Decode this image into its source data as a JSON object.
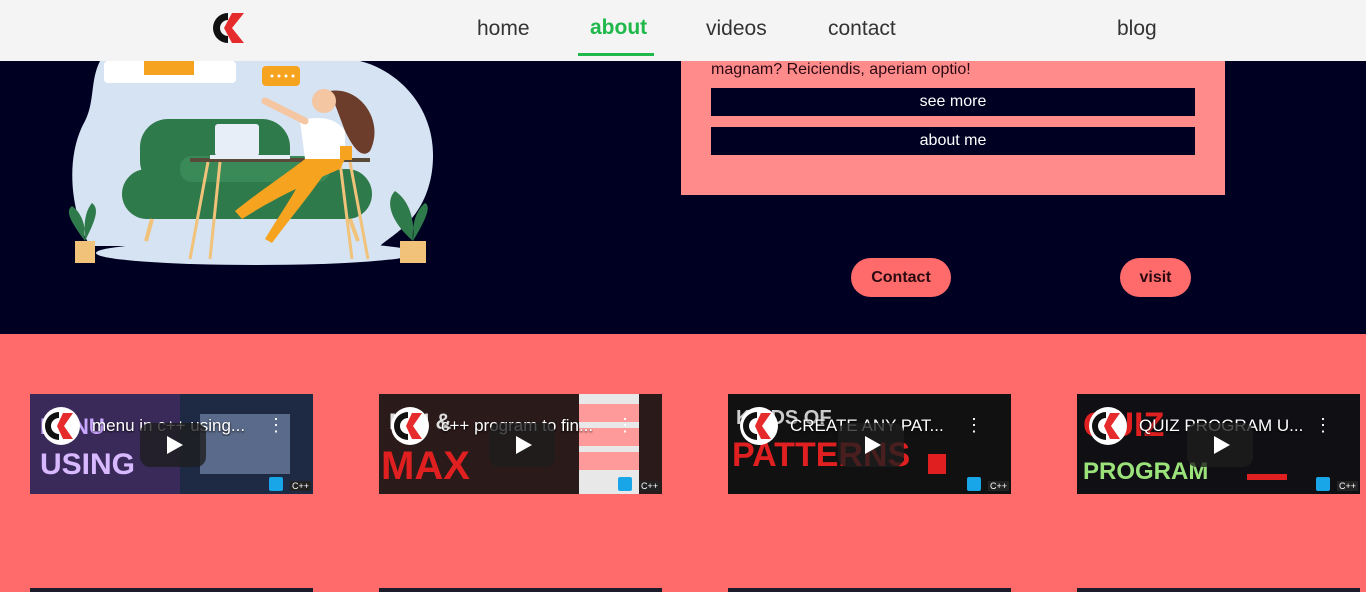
{
  "nav": {
    "links": [
      {
        "label": "home"
      },
      {
        "label": "about",
        "active": true
      },
      {
        "label": "videos"
      },
      {
        "label": "contact"
      },
      {
        "label": "blog"
      }
    ]
  },
  "about_card": {
    "text_tail": "magnam? Reiciendis, aperiam optio!",
    "see_more_label": "see more",
    "about_me_label": "about me"
  },
  "hero": {
    "contact_label": "Contact",
    "visit_label": "visit"
  },
  "videos": [
    {
      "title": "menu in c++ using...",
      "thumb_text_1": "MENU",
      "thumb_text_2": "USING",
      "tag": "C++"
    },
    {
      "title": "c++ program to fin...",
      "thumb_text_1": "MIN &",
      "thumb_text_2": "MAX",
      "tag": "C++"
    },
    {
      "title": "CREATE ANY PAT...",
      "thumb_text_1": "KINDS OF",
      "thumb_text_2": "PATTERNS",
      "tag": "C++"
    },
    {
      "title": "QUIZ PROGRAM U...",
      "thumb_text_1": "QUIZ",
      "thumb_text_2": "PROGRAM",
      "tag": "C++"
    }
  ],
  "colors": {
    "nav_bg": "#f4f4f4",
    "active": "#1fb84a",
    "hero_bg": "#000022",
    "card_bg": "#ff8b8b",
    "section_bg": "#ff6b6b"
  }
}
